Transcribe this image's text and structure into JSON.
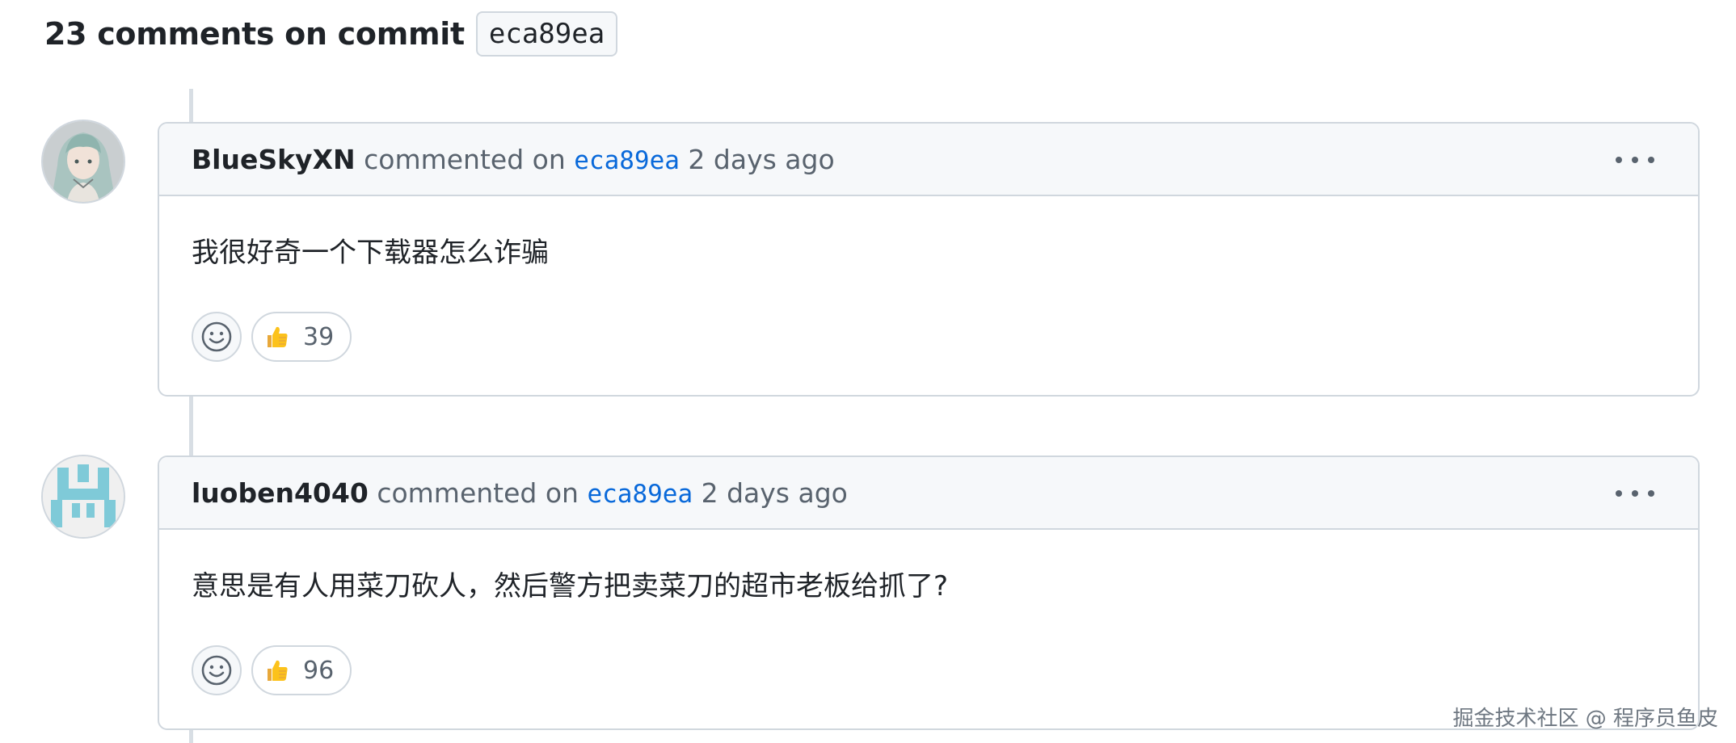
{
  "header": {
    "title": "23 comments on commit",
    "sha": "eca89ea"
  },
  "comments": [
    {
      "author": "BlueSkyXN",
      "action": "commented on",
      "commit": "eca89ea",
      "time": "2 days ago",
      "body": "我很好奇一个下载器怎么诈骗",
      "reaction_emoji": "thumbs-up-icon",
      "reaction_count": "39"
    },
    {
      "author": "luoben4040",
      "action": "commented on",
      "commit": "eca89ea",
      "time": "2 days ago",
      "body": "意思是有人用菜刀砍人，然后警方把卖菜刀的超市老板给抓了?",
      "reaction_emoji": "thumbs-up-icon",
      "reaction_count": "96"
    }
  ],
  "watermark": "掘金技术社区 @ 程序员鱼皮",
  "colors": {
    "link": "#0969da",
    "border": "#d0d7de",
    "header_bg": "#f6f8fa",
    "muted_text": "#59636e",
    "identicon": "#7fcad8"
  }
}
